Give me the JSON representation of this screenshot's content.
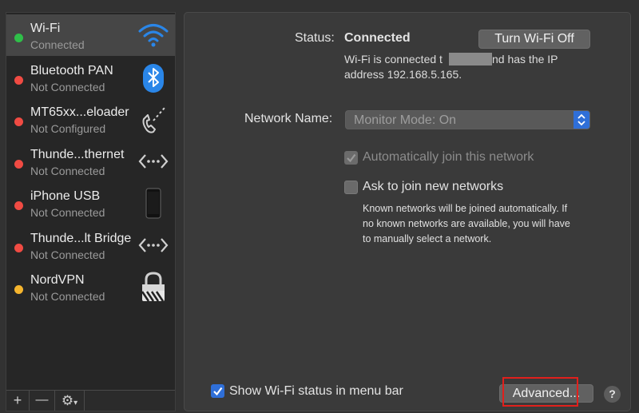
{
  "services": [
    {
      "name": "Wi-Fi",
      "status": "Connected",
      "dot": "#2fbf49",
      "icon": "wifi-icon",
      "selected": true
    },
    {
      "name": "Bluetooth PAN",
      "status": "Not Connected",
      "dot": "#f04b43",
      "icon": "bluetooth-icon"
    },
    {
      "name": "MT65xx...eloader",
      "status": "Not Configured",
      "dot": "#f04b43",
      "icon": "phone-icon"
    },
    {
      "name": "Thunde...thernet",
      "status": "Not Connected",
      "dot": "#f04b43",
      "icon": "thunderbolt-arrows-icon"
    },
    {
      "name": "iPhone USB",
      "status": "Not Connected",
      "dot": "#f04b43",
      "icon": "iphone-icon"
    },
    {
      "name": "Thunde...lt Bridge",
      "status": "Not Connected",
      "dot": "#f04b43",
      "icon": "bridge-arrows-icon"
    },
    {
      "name": "NordVPN",
      "status": "Not Connected",
      "dot": "#f5b52e",
      "icon": "lock-icon"
    }
  ],
  "footer": {
    "add": "+",
    "remove": "—",
    "gear": "⚙"
  },
  "main": {
    "status_label": "Status:",
    "status_value": "Connected",
    "turn_off_button": "Turn Wi-Fi Off",
    "status_desc_1": "Wi-Fi is connected t",
    "status_desc_2": "nd has the IP",
    "status_desc_3": "address 192.168.5.165.",
    "network_name_label": "Network Name:",
    "network_name_value": "Monitor Mode: On",
    "auto_join_label": "Automatically join this network",
    "ask_join_label": "Ask to join new networks",
    "ask_join_desc_1": "Known networks will be joined automatically. If",
    "ask_join_desc_2": "no known networks are available, you will have",
    "ask_join_desc_3": "to manually select a network.",
    "show_status_label": "Show Wi-Fi status in menu bar",
    "advanced_button": "Advanced...",
    "help_button": "?"
  },
  "colors": {
    "accent": "#2f6fd8",
    "highlight": "#e0201c"
  }
}
